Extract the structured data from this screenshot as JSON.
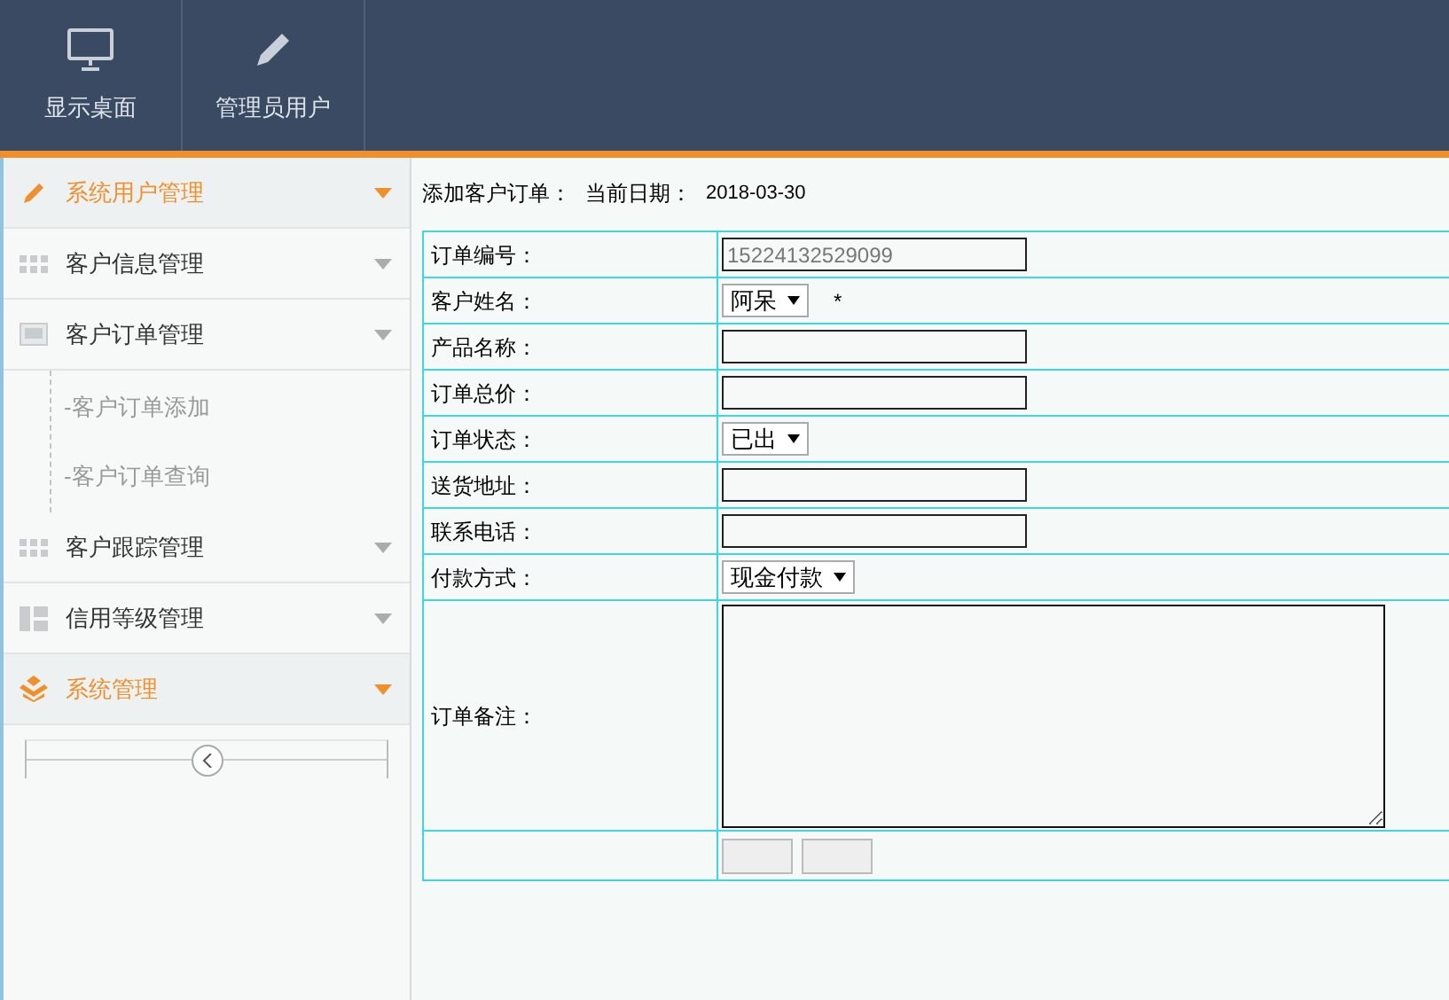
{
  "header": {
    "nav_items": [
      {
        "kind": "monitor",
        "label": "显示桌面"
      },
      {
        "kind": "pencil",
        "label": "管理员用户"
      }
    ]
  },
  "sidebar": {
    "items": [
      {
        "kind": "pencil",
        "label": "系统用户管理",
        "selected": true
      },
      {
        "kind": "grid",
        "label": "客户信息管理",
        "selected": false
      },
      {
        "kind": "image",
        "label": "客户订单管理",
        "selected": false,
        "children": [
          {
            "label": "-客户订单添加"
          },
          {
            "label": "-客户订单查询"
          }
        ]
      },
      {
        "kind": "grid",
        "label": "客户跟踪管理",
        "selected": false
      },
      {
        "kind": "layout",
        "label": "信用等级管理",
        "selected": false
      },
      {
        "kind": "box",
        "label": "系统管理",
        "selected": true
      }
    ]
  },
  "form": {
    "title": "添加客户订单：",
    "date_label": "当前日期：",
    "date": "2018-03-30",
    "rows": [
      {
        "label": "订单编号：",
        "kind": "text",
        "value": "15224132529099",
        "readonly": true
      },
      {
        "label": "客户姓名：",
        "kind": "select",
        "value": "阿呆",
        "required_mark": "*"
      },
      {
        "label": "产品名称：",
        "kind": "text"
      },
      {
        "label": "订单总价：",
        "kind": "text"
      },
      {
        "label": "订单状态：",
        "kind": "select",
        "value": "已出"
      },
      {
        "label": "送货地址：",
        "kind": "text"
      },
      {
        "label": "联系电话：",
        "kind": "text"
      },
      {
        "label": "付款方式：",
        "kind": "select",
        "value": "现金付款"
      },
      {
        "label": "订单备注：",
        "kind": "textarea"
      }
    ],
    "buttons": [
      {
        "kind": "button"
      },
      {
        "kind": "button"
      }
    ]
  }
}
